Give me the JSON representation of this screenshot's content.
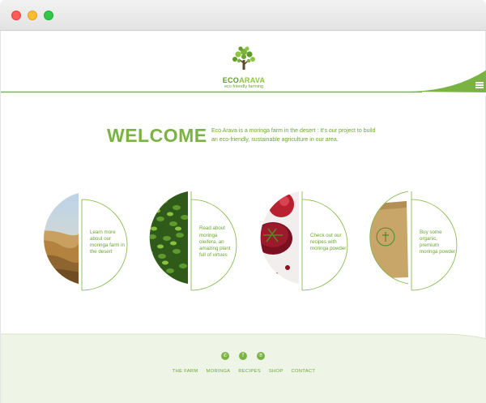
{
  "window": {
    "buttons": [
      "close",
      "minimize",
      "zoom"
    ]
  },
  "header": {
    "logo_name_part1": "ECO",
    "logo_name_part2": "ARAVA",
    "logo_tagline": "eco friendly farming",
    "menu_icon": "hamburger-icon"
  },
  "intro": {
    "title": "WELCOME",
    "text": "Eco Arava is a moringa farm in the desert : It's our project to build an eco-friendly, sustainable agriculture in our area."
  },
  "cards": [
    {
      "text": "Learn more about our moringa farm in the desert",
      "image": "desert-photo"
    },
    {
      "text": "Read about moringa oleifera, an amazing plant full of virtues",
      "image": "moringa-leaves-photo"
    },
    {
      "text": "Check out our recipes with moringa powder",
      "image": "smoothie-photo"
    },
    {
      "text": "Buy some organic, premium moringa powder",
      "image": "powder-bag-photo"
    }
  ],
  "footer": {
    "socials": [
      "whatsapp-icon",
      "facebook-icon",
      "pinterest-icon"
    ],
    "nav": [
      "THE FARM",
      "MORINGA",
      "RECIPES",
      "SHOP",
      "CONTACT"
    ]
  },
  "colors": {
    "brand_green": "#7ab342",
    "dark_green": "#5f9b2a",
    "footer_bg": "#eef4e6"
  }
}
